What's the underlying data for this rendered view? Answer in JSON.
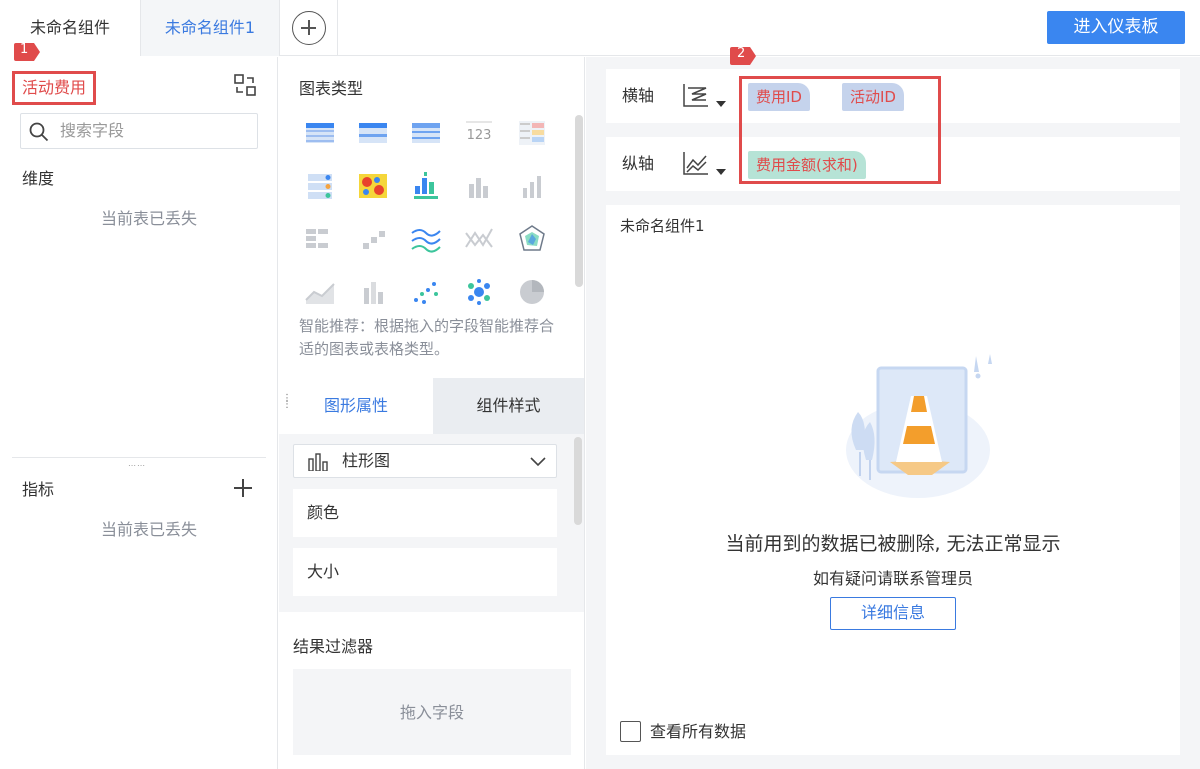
{
  "tabs": [
    {
      "label": "未命名组件"
    },
    {
      "label": "未命名组件1"
    }
  ],
  "header": {
    "enter_dashboard": "进入仪表板"
  },
  "left_panel": {
    "table_name": "活动费用",
    "search_placeholder": "搜索字段",
    "dimension_label": "维度",
    "dimension_empty": "当前表已丢失",
    "metric_label": "指标",
    "metric_empty": "当前表已丢失"
  },
  "middle_panel": {
    "chart_type_title": "图表类型",
    "chart_icons": [
      "table-grouped-icon",
      "table-detail-icon",
      "table-cross-icon",
      "kpi-number-icon",
      "color-table-icon",
      "indicator-card-icon",
      "heatmap-icon",
      "bar-grouped-icon",
      "bar-icon",
      "bar-small-icon",
      "funnel-icon",
      "waterfall-icon",
      "multi-line-icon",
      "line-cross-icon",
      "radar-icon",
      "area-icon",
      "stacked-bar-icon",
      "scatter-icon",
      "bubble-icon",
      "pie-icon"
    ],
    "recommend_hint": "智能推荐：根据拖入的字段智能推荐合适的图表或表格类型。",
    "tab_graph_props": "图形属性",
    "tab_component_style": "组件样式",
    "selected_chart": "柱形图",
    "prop_color": "颜色",
    "prop_size": "大小",
    "filter_title": "结果过滤器",
    "filter_placeholder": "拖入字段"
  },
  "right_panel": {
    "x_axis_label": "横轴",
    "y_axis_label": "纵轴",
    "x_fields": [
      "费用ID",
      "活动ID"
    ],
    "y_fields": [
      "费用金额(求和)"
    ],
    "component_title": "未命名组件1",
    "error_main": "当前用到的数据已被删除, 无法正常显示",
    "error_sub": "如有疑问请联系管理员",
    "detail_button": "详细信息",
    "view_all_data": "查看所有数据"
  },
  "annotations": {
    "step1": "1",
    "step2": "2"
  },
  "colors": {
    "accent": "#3a86f0",
    "highlight_red": "#e04b4b",
    "pill_blue": "#c5d3ec",
    "pill_green": "#b6e3d6"
  }
}
